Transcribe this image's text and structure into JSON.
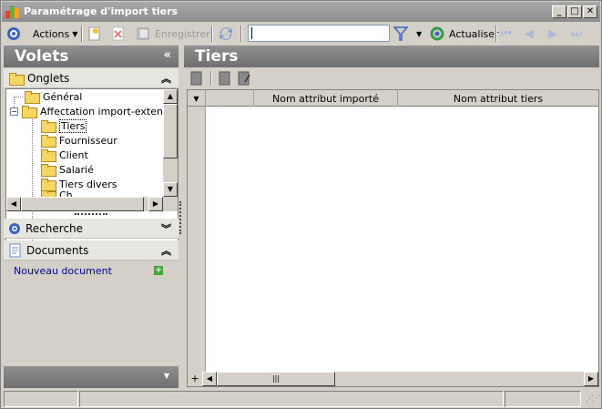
{
  "window": {
    "title": "Paramétrage d'import tiers"
  },
  "toolbar": {
    "actions_label": "Actions",
    "save_label": "Enregistrer",
    "search_value": "",
    "refresh_label": "Actualiser"
  },
  "left_pane": {
    "title": "Volets",
    "onglets_label": "Onglets",
    "tree": {
      "general": "Général",
      "affectation": "Affectation import-extensio",
      "items": [
        "Tiers",
        "Fournisseur",
        "Client",
        "Salarié",
        "Tiers divers",
        "Ch..."
      ]
    },
    "recherche_label": "Recherche",
    "documents_label": "Documents",
    "new_document_label": "Nouveau document"
  },
  "right_pane": {
    "title": "Tiers",
    "columns": [
      "Nom attribut importé",
      "Nom attribut tiers"
    ]
  },
  "colors": {
    "header_dark": "#6f6f6f",
    "folder": "#f6d65f",
    "link": "#0000a0",
    "accent_blue": "#3b63c4"
  }
}
